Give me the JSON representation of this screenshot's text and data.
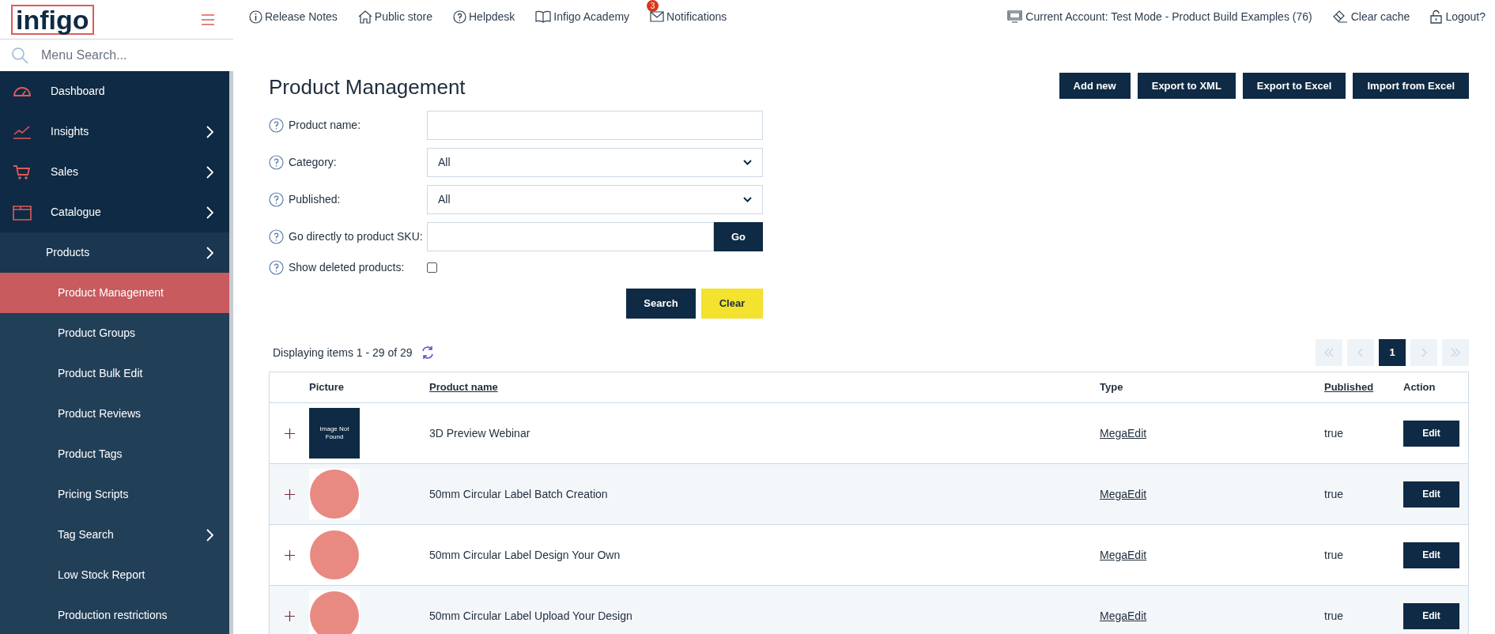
{
  "logo": "infigo",
  "menu_search": {
    "placeholder": "Menu Search..."
  },
  "sidebar": {
    "items": [
      {
        "label": "Dashboard",
        "expandable": false,
        "selected": false
      },
      {
        "label": "Insights",
        "expandable": true,
        "selected": false
      },
      {
        "label": "Sales",
        "expandable": true,
        "selected": false
      },
      {
        "label": "Catalogue",
        "expandable": true,
        "selected": false,
        "children": [
          {
            "label": "Products",
            "expandable": true,
            "selected": false,
            "children": [
              {
                "label": "Product Management",
                "expandable": false,
                "selected": true
              },
              {
                "label": "Product Groups",
                "expandable": false,
                "selected": false
              },
              {
                "label": "Product Bulk Edit",
                "expandable": false,
                "selected": false
              },
              {
                "label": "Product Reviews",
                "expandable": false,
                "selected": false
              },
              {
                "label": "Product Tags",
                "expandable": false,
                "selected": false
              },
              {
                "label": "Pricing Scripts",
                "expandable": false,
                "selected": false
              },
              {
                "label": "Tag Search",
                "expandable": true,
                "selected": false
              },
              {
                "label": "Low Stock Report",
                "expandable": false,
                "selected": false
              },
              {
                "label": "Production restrictions",
                "expandable": false,
                "selected": false
              }
            ]
          }
        ]
      }
    ]
  },
  "top_links": [
    {
      "label": "Release Notes"
    },
    {
      "label": "Public store"
    },
    {
      "label": "Helpdesk"
    },
    {
      "label": "Infigo Academy"
    },
    {
      "label": "Notifications",
      "badge": "3"
    }
  ],
  "account_links": [
    {
      "label": "Current Account: Test Mode - Product Build Examples (76)"
    },
    {
      "label": "Clear cache"
    },
    {
      "label": "Logout?"
    }
  ],
  "title": "Product Management",
  "header_buttons": [
    "Add new",
    "Export to XML",
    "Export to Excel",
    "Import from Excel"
  ],
  "filters": [
    {
      "kind": "text",
      "label": "Product name:"
    },
    {
      "kind": "select",
      "label": "Category:",
      "value": "All"
    },
    {
      "kind": "select",
      "label": "Published:",
      "value": "All"
    },
    {
      "kind": "sku",
      "label": "Go directly to product SKU:",
      "button": "Go"
    },
    {
      "kind": "checkbox",
      "label": "Show deleted products:",
      "checked": false
    }
  ],
  "search_button": "Search",
  "clear_button": "Clear",
  "summary": "Displaying items 1 - 29 of 29",
  "pager": {
    "pages": [
      {
        "label": "1",
        "selected": true
      }
    ]
  },
  "table": {
    "columns": [
      {
        "label": "Picture",
        "sortable": false
      },
      {
        "label": "Product name",
        "sortable": true
      },
      {
        "label": "Type",
        "sortable": false
      },
      {
        "label": "Published",
        "sortable": true
      },
      {
        "label": "Action",
        "sortable": false
      }
    ],
    "rows": [
      {
        "picture": {
          "kind": "placeholder",
          "text": "Image Not Found"
        },
        "name": "3D Preview Webinar",
        "type": "MegaEdit",
        "published": "true",
        "action": "Edit"
      },
      {
        "picture": {
          "kind": "photo"
        },
        "name": "50mm Circular Label Batch Creation",
        "type": "MegaEdit",
        "published": "true",
        "action": "Edit"
      },
      {
        "picture": {
          "kind": "photo"
        },
        "name": "50mm Circular Label Design Your Own",
        "type": "MegaEdit",
        "published": "true",
        "action": "Edit"
      },
      {
        "picture": {
          "kind": "photo"
        },
        "name": "50mm Circular Label Upload Your Design",
        "type": "MegaEdit",
        "published": "true",
        "action": "Edit"
      }
    ]
  }
}
